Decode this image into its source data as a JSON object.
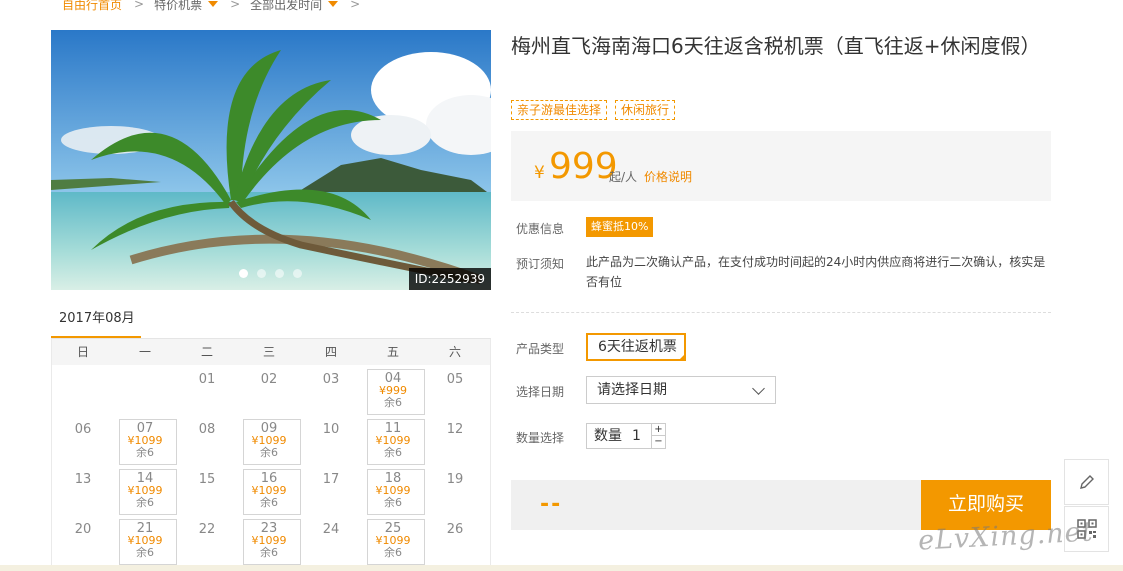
{
  "breadcrumb": {
    "home": "自由行首页",
    "items": [
      "特价机票",
      "全部出发时间"
    ]
  },
  "hero": {
    "id_label": "ID:2252939",
    "slide_count": 4,
    "active_slide": 1
  },
  "calendar": {
    "month": "2017年08月",
    "weekdays": [
      "日",
      "一",
      "二",
      "三",
      "四",
      "五",
      "六"
    ],
    "days": [
      {
        "d": ""
      },
      {
        "d": ""
      },
      {
        "d": "01"
      },
      {
        "d": "02"
      },
      {
        "d": "03"
      },
      {
        "d": "04",
        "price": "¥999",
        "left": "余6"
      },
      {
        "d": "05"
      },
      {
        "d": "06"
      },
      {
        "d": "07",
        "price": "¥1099",
        "left": "余6"
      },
      {
        "d": "08"
      },
      {
        "d": "09",
        "price": "¥1099",
        "left": "余6"
      },
      {
        "d": "10"
      },
      {
        "d": "11",
        "price": "¥1099",
        "left": "余6"
      },
      {
        "d": "12"
      },
      {
        "d": "13"
      },
      {
        "d": "14",
        "price": "¥1099",
        "left": "余6"
      },
      {
        "d": "15"
      },
      {
        "d": "16",
        "price": "¥1099",
        "left": "余6"
      },
      {
        "d": "17"
      },
      {
        "d": "18",
        "price": "¥1099",
        "left": "余6"
      },
      {
        "d": "19"
      },
      {
        "d": "20"
      },
      {
        "d": "21",
        "price": "¥1099",
        "left": "余6"
      },
      {
        "d": "22"
      },
      {
        "d": "23",
        "price": "¥1099",
        "left": "余6"
      },
      {
        "d": "24"
      },
      {
        "d": "25",
        "price": "¥1099",
        "left": "余6"
      },
      {
        "d": "26"
      }
    ]
  },
  "product": {
    "title": "梅州直飞海南海口6天往返含税机票（直飞往返+休闲度假）",
    "tags": [
      "亲子游最佳选择",
      "休闲旅行"
    ],
    "price_symbol": "¥",
    "price": "999",
    "price_unit": "起/人",
    "price_explain": "价格说明"
  },
  "info": {
    "promo_label": "优惠信息",
    "promo_value": "蜂蜜抵10%",
    "notice_label": "预订须知",
    "notice_text": "此产品为二次确认产品，在支付成功时间起的24小时内供应商将进行二次确认，核实是否有位"
  },
  "form": {
    "type_label": "产品类型",
    "type_value": "6天往返机票",
    "date_label": "选择日期",
    "date_value": "请选择日期",
    "qty_label": "数量选择",
    "qty_field_label": "数量",
    "qty_value": "1",
    "plus": "+",
    "minus": "−"
  },
  "buy": {
    "total": "--",
    "button": "立即购买"
  },
  "watermark": "eLvXing.net",
  "colors": {
    "accent": "#f39800",
    "accent_text": "#f08a00"
  }
}
